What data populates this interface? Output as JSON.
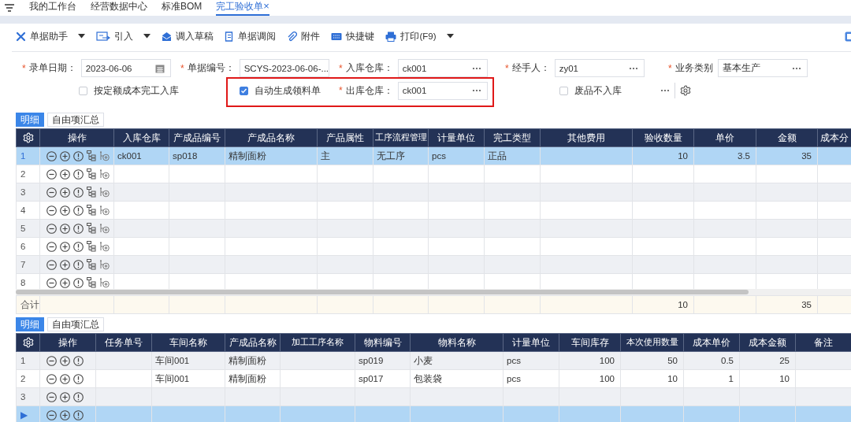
{
  "tabs": [
    {
      "label": "我的工作台",
      "selected": false
    },
    {
      "label": "经营数据中心",
      "selected": false
    },
    {
      "label": "标准BOM",
      "selected": false
    },
    {
      "label": "完工验收单",
      "selected": true,
      "close": "×"
    }
  ],
  "toolbar": [
    {
      "label": "单据助手",
      "menu": true
    },
    {
      "label": "引入",
      "menu": true
    },
    {
      "label": "调入草稿",
      "menu": false
    },
    {
      "label": "单据调阅",
      "menu": false
    },
    {
      "label": "附件",
      "menu": false
    },
    {
      "label": "快捷键",
      "menu": false
    },
    {
      "label": "打印(F9)",
      "menu": true
    }
  ],
  "form": {
    "rows": [
      [
        {
          "kind": "date_field",
          "required_mark": "*",
          "label": "录单日期：",
          "value": "2023-06-06"
        },
        {
          "kind": "text_field",
          "required_mark": "*",
          "label": "单据编号：",
          "value": "SCYS-2023-06-06-..."
        },
        {
          "kind": "lookup_field",
          "required_mark": "*",
          "label": "入库仓库：",
          "value": "ck001"
        },
        {
          "kind": "lookup_field",
          "required_mark": "*",
          "label": "经手人：",
          "value": "zy01"
        },
        {
          "kind": "lookup_field",
          "required_mark": "*",
          "label": "业务类别",
          "value": "基本生产"
        }
      ],
      [
        {
          "kind": "checkbox",
          "label": "按定额成本完工入库",
          "checked": false
        },
        {
          "kind": "checkbox",
          "label": "自动生成领料单",
          "checked": true
        },
        {
          "kind": "lookup_field",
          "required_mark": "*",
          "label": "出库仓库：",
          "value": "ck001"
        },
        {
          "kind": "checkbox",
          "label": "废品不入库",
          "checked": false
        },
        {
          "kind": "tools"
        }
      ]
    ]
  },
  "detail_table": {
    "tabs": [
      {
        "label": "明细",
        "selected": true
      },
      {
        "label": "自由项汇总",
        "selected": false
      }
    ],
    "columns": [
      {
        "label": "操作"
      },
      {
        "label": "入库仓库"
      },
      {
        "label": "产成品编号"
      },
      {
        "label": "产成品名称"
      },
      {
        "label": "产品属性"
      },
      {
        "label": "工序流程管理"
      },
      {
        "label": "计量单位"
      },
      {
        "label": "完工类型"
      },
      {
        "label": "其他费用"
      },
      {
        "label": "验收数量"
      },
      {
        "label": "单价"
      },
      {
        "label": "金额"
      },
      {
        "label": "成本分"
      }
    ],
    "rows": [
      {
        "number": "1",
        "selected": true,
        "cells": [
          "ck001",
          "sp018",
          "精制面粉",
          "主",
          "无工序",
          "pcs",
          "正品",
          null,
          "10",
          "3.5",
          "35",
          null
        ]
      },
      {
        "number": "2",
        "selected": false
      },
      {
        "number": "3",
        "selected": false
      },
      {
        "number": "4",
        "selected": false
      },
      {
        "number": "5",
        "selected": false
      },
      {
        "number": "6",
        "selected": false
      },
      {
        "number": "7",
        "selected": false
      },
      {
        "number": "8",
        "selected": false
      }
    ],
    "footer": {
      "label": "合计",
      "cells": [
        null,
        null,
        null,
        null,
        null,
        null,
        null,
        null,
        "10",
        null,
        "35",
        null
      ]
    }
  },
  "material_table": {
    "tabs": [
      {
        "label": "明细",
        "selected": true
      },
      {
        "label": "自由项汇总",
        "selected": false
      }
    ],
    "columns": [
      {
        "label": "操作"
      },
      {
        "label": "任务单号"
      },
      {
        "label": "车间名称"
      },
      {
        "label": "产成品名称"
      },
      {
        "label": "加工工序名称"
      },
      {
        "label": "物料编号"
      },
      {
        "label": "物料名称"
      },
      {
        "label": "计量单位"
      },
      {
        "label": "车间库存"
      },
      {
        "label": "本次使用数量"
      },
      {
        "label": "成本单价"
      },
      {
        "label": "成本金额"
      },
      {
        "label": "备注"
      }
    ],
    "rows": [
      {
        "number": "1",
        "selected": false,
        "cells": [
          null,
          "车间001",
          "精制面粉",
          null,
          "sp019",
          "小麦",
          "pcs",
          "100",
          "50",
          "0.5",
          "25",
          null
        ]
      },
      {
        "number": "2",
        "selected": false,
        "cells": [
          null,
          "车间001",
          "精制面粉",
          null,
          "sp017",
          "包装袋",
          "pcs",
          "100",
          "10",
          "1",
          "10",
          null
        ]
      },
      {
        "number": "3",
        "selected": false
      },
      {
        "number": "▶",
        "selected": true
      }
    ]
  }
}
